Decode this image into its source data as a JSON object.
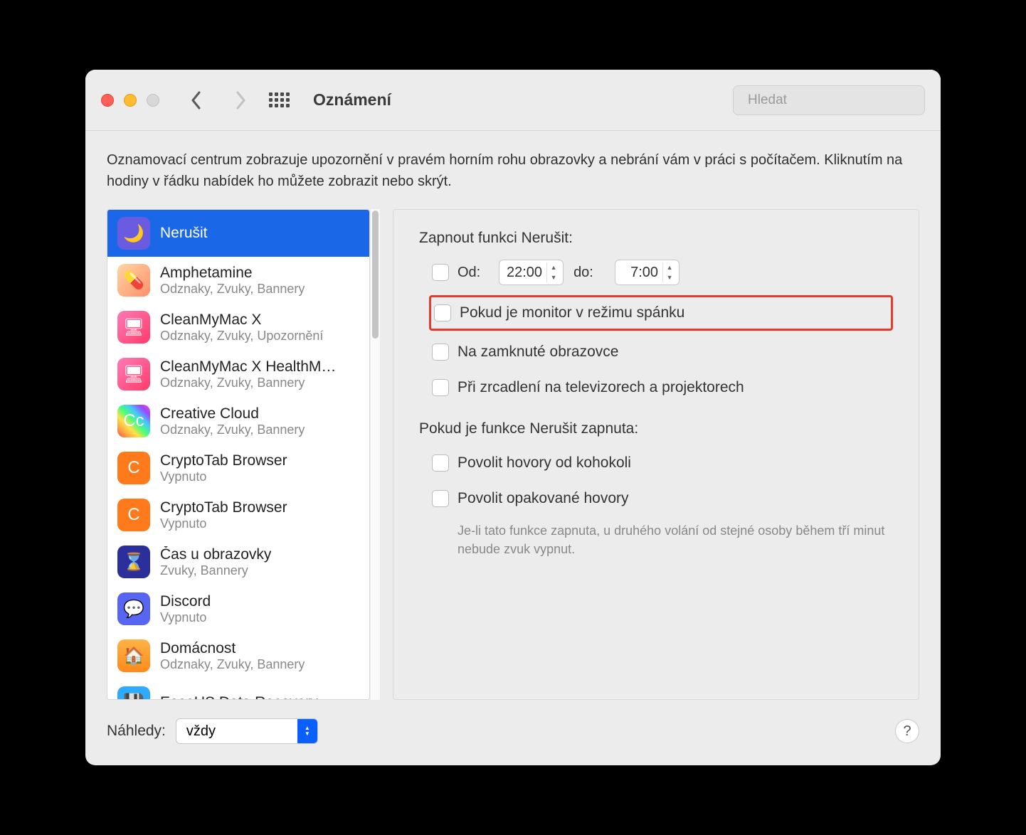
{
  "window": {
    "title": "Oznámení"
  },
  "search": {
    "placeholder": "Hledat"
  },
  "intro": "Oznamovací centrum zobrazuje upozornění v pravém horním rohu obrazovky a nebrání vám v práci s počítačem. Kliknutím na hodiny v řádku nabídek ho můžete zobrazit nebo skrýt.",
  "sidebar": {
    "items": [
      {
        "name": "Nerušit",
        "sub": "",
        "icon": "moon-icon",
        "iconClass": "ic-moon",
        "selected": true
      },
      {
        "name": "Amphetamine",
        "sub": "Odznaky, Zvuky, Bannery",
        "icon": "amphetamine-icon",
        "iconClass": "ic-amph"
      },
      {
        "name": "CleanMyMac X",
        "sub": "Odznaky, Zvuky, Upozornění",
        "icon": "cleanmymac-icon",
        "iconClass": "ic-cmm"
      },
      {
        "name": "CleanMyMac X HealthM…",
        "sub": "Odznaky, Zvuky, Bannery",
        "icon": "cleanmymac-icon",
        "iconClass": "ic-cmm"
      },
      {
        "name": "Creative Cloud",
        "sub": "Odznaky, Zvuky, Bannery",
        "icon": "creative-cloud-icon",
        "iconClass": "ic-cc"
      },
      {
        "name": "CryptoTab Browser",
        "sub": "Vypnuto",
        "icon": "cryptotab-icon",
        "iconClass": "ic-crypto"
      },
      {
        "name": "CryptoTab Browser",
        "sub": "Vypnuto",
        "icon": "cryptotab-icon",
        "iconClass": "ic-crypto"
      },
      {
        "name": "Čas u obrazovky",
        "sub": "Zvuky, Bannery",
        "icon": "screentime-icon",
        "iconClass": "ic-screen"
      },
      {
        "name": "Discord",
        "sub": "Vypnuto",
        "icon": "discord-icon",
        "iconClass": "ic-discord"
      },
      {
        "name": "Domácnost",
        "sub": "Odznaky, Zvuky, Bannery",
        "icon": "home-icon",
        "iconClass": "ic-home"
      },
      {
        "name": "EaseUS Data Recovery…",
        "sub": "",
        "icon": "easeus-icon",
        "iconClass": "ic-ease"
      }
    ]
  },
  "detail": {
    "section1_title": "Zapnout funkci Nerušit:",
    "from_label": "Od:",
    "from_time": "22:00",
    "to_label": "do:",
    "to_time": "7:00",
    "opt_sleep": "Pokud je monitor v režimu spánku",
    "opt_locked": "Na zamknuté obrazovce",
    "opt_mirror": "Při zrcadlení na televizorech a projektorech",
    "section2_title": "Pokud je funkce Nerušit zapnuta:",
    "opt_anyone": "Povolit hovory od kohokoli",
    "opt_repeated": "Povolit opakované hovory",
    "hint": "Je-li tato funkce zapnuta, u druhého volání od stejné osoby během tří minut nebude zvuk vypnut."
  },
  "footer": {
    "label": "Náhledy:",
    "value": "vždy"
  }
}
